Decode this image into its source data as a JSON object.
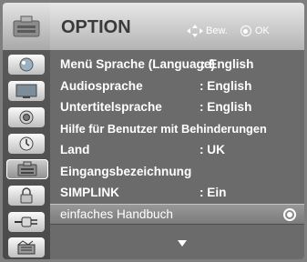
{
  "header": {
    "title": "OPTION",
    "move_hint": "Bew.",
    "ok_hint": "OK"
  },
  "menu": {
    "items": [
      {
        "label": "Menü Sprache (Language)",
        "value": ": English"
      },
      {
        "label": "Audiosprache",
        "value": ": English"
      },
      {
        "label": "Untertitelsprache",
        "value": ": English"
      },
      {
        "label": "Hilfe für Benutzer mit Behinderungen",
        "value": ""
      },
      {
        "label": "Land",
        "value": ": UK"
      },
      {
        "label": "Eingangsbezeichnung",
        "value": ""
      },
      {
        "label": "SIMPLINK",
        "value": ": Ein"
      },
      {
        "label": "einfaches Handbuch",
        "value": ""
      }
    ]
  },
  "sidebar": {
    "icons": [
      "picture-icon",
      "screen-icon",
      "audio-icon",
      "time-icon",
      "option-icon",
      "lock-icon",
      "input-icon",
      "usb-icon"
    ],
    "active_index": 4
  },
  "colors": {
    "panel": "#6b6b6b",
    "header": "#c8c8c8",
    "text": "#ffffff",
    "title": "#3a3a3a"
  }
}
